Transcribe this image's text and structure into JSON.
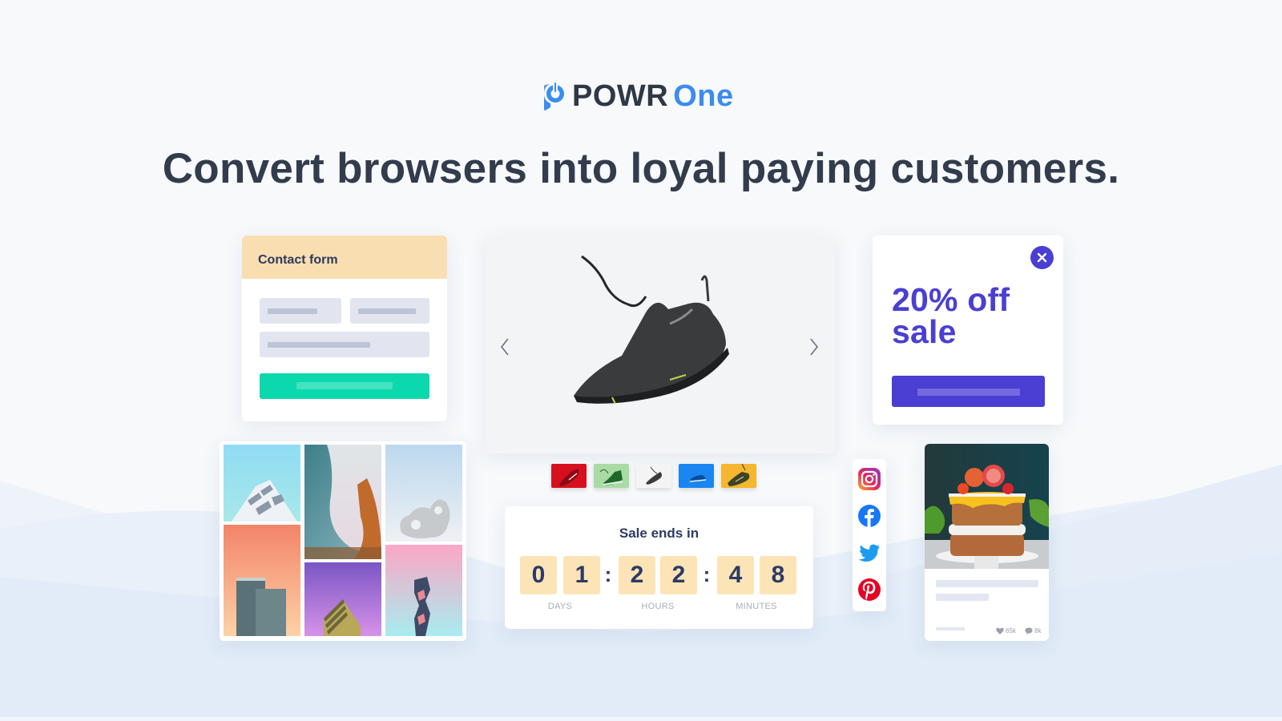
{
  "brand": {
    "name_part1": "POWR",
    "name_part2": "One",
    "primary_color": "#3b8cf0",
    "dark_color": "#2f3846"
  },
  "headline": "Convert browsers into loyal paying customers.",
  "contact_form": {
    "title": "Contact form",
    "header_color": "#f8deb1",
    "submit_color": "#0bd8ac"
  },
  "gallery": {
    "tiles": [
      {
        "subject": "white balcony building, blue sky"
      },
      {
        "subject": "curved glass towers"
      },
      {
        "subject": "white abstract sculpture"
      },
      {
        "subject": "office towers, orange sky"
      },
      {
        "subject": "striped skyscraper, purple sky"
      },
      {
        "subject": "geometric tower, pink sky"
      }
    ]
  },
  "product_slider": {
    "main_image": "black running shoe",
    "prev_icon": "chevron-left-icon",
    "next_icon": "chevron-right-icon",
    "thumbnails": [
      {
        "color": "#d6101e",
        "label": "red shoe"
      },
      {
        "color": "#a9dca4",
        "label": "green high-top"
      },
      {
        "color": "#f4f4f4",
        "label": "black shoe",
        "selected": true
      },
      {
        "color": "#1b86f0",
        "label": "blue shoe"
      },
      {
        "color": "#f5b630",
        "label": "olive shoe"
      }
    ]
  },
  "countdown": {
    "title": "Sale ends in",
    "digits": [
      "0",
      "1",
      "2",
      "2",
      "4",
      "8"
    ],
    "separator": ":",
    "labels": [
      "DAYS",
      "HOURS",
      "MINUTES"
    ]
  },
  "popup": {
    "title": "20% off sale",
    "accent_color": "#4a3fd2",
    "close_icon": "close-icon"
  },
  "social": {
    "icons": [
      "instagram-icon",
      "facebook-icon",
      "twitter-icon",
      "pinterest-icon"
    ]
  },
  "post": {
    "image": "layered cake with blood orange",
    "likes": "65k",
    "comments": "8k"
  }
}
